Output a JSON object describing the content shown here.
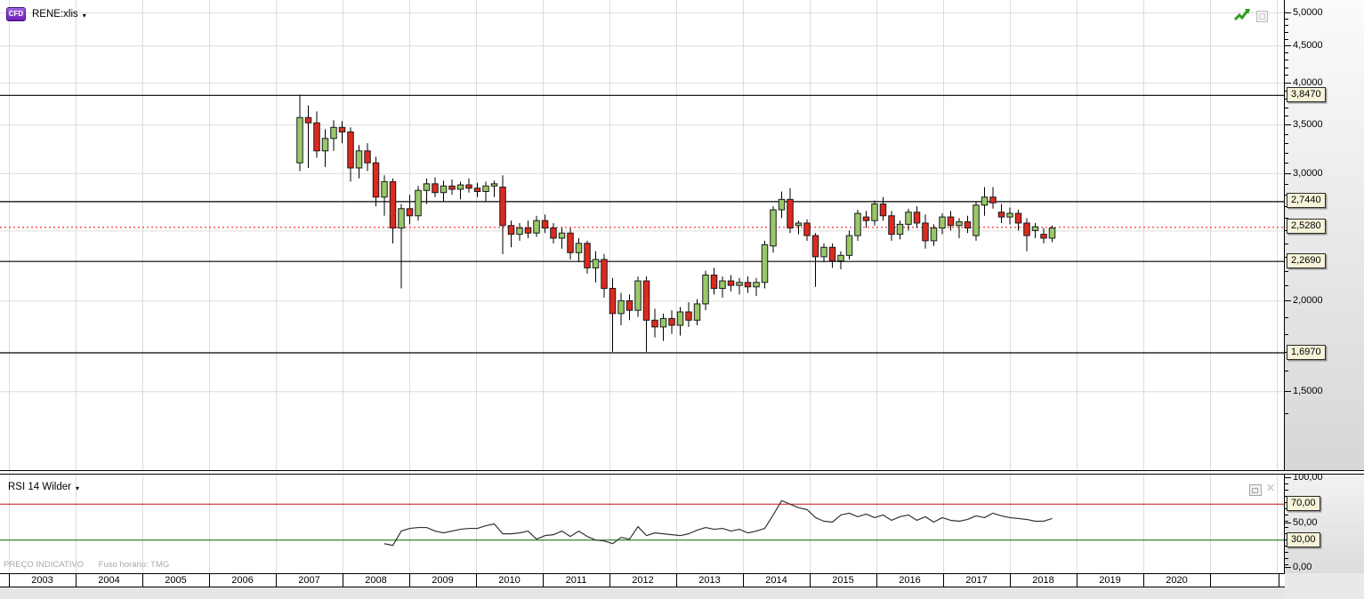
{
  "header": {
    "badge": "CFD",
    "symbol": "RENE:xlis",
    "caret": "▾"
  },
  "rsi_panel": {
    "label": "RSI 14 Wilder",
    "caret": "▾",
    "close_glyph": "✕"
  },
  "footer": {
    "price_note": "PREÇO INDICATIVO",
    "timezone_note": "Fuso horário: TMG"
  },
  "price_axis": {
    "labels": [
      [
        "5,0000",
        5.0
      ],
      [
        "4,5000",
        4.5
      ],
      [
        "4,0000",
        4.0
      ],
      [
        "3,5000",
        3.5
      ],
      [
        "3,0000",
        3.0
      ],
      [
        "2,0000",
        2.0
      ],
      [
        "1,5000",
        1.5
      ]
    ],
    "level_boxes": [
      [
        "3,8470",
        3.847
      ],
      [
        "2,7440",
        2.744
      ],
      [
        "2,5280",
        2.528
      ],
      [
        "2,2690",
        2.269
      ],
      [
        "1,6970",
        1.697
      ]
    ]
  },
  "rsi_axis": {
    "labels": [
      [
        "100,00",
        100
      ],
      [
        "50,00",
        50
      ],
      [
        "0,00",
        0
      ]
    ],
    "level_boxes": [
      [
        "70,00",
        70
      ],
      [
        "30,00",
        30
      ]
    ]
  },
  "time_axis": {
    "years": [
      "2003",
      "2004",
      "2005",
      "2006",
      "2007",
      "2008",
      "2009",
      "2010",
      "2011",
      "2012",
      "2013",
      "2014",
      "2015",
      "2016",
      "2017",
      "2018",
      "2019",
      "2020"
    ]
  },
  "icons": {
    "trend_icon": "green-zigzag-up-arrow",
    "collapse_icon": "square-button",
    "restore_icon": "restore-button",
    "close_icon": "close-button"
  },
  "chart_data": [
    {
      "type": "candlestick",
      "title": "RENE:xlis",
      "y_scale": "log",
      "ylim": [
        1.35,
        5.05
      ],
      "grid_prices": [
        5.0,
        4.5,
        4.0,
        3.5,
        3.0,
        2.5,
        2.0,
        1.5
      ],
      "level_lines": {
        "color": "#000000",
        "prices": [
          3.847,
          2.744,
          2.269,
          1.697
        ]
      },
      "last_price_line": {
        "price": 2.528,
        "color": "#ff0000",
        "style": "dotted"
      },
      "up_color": "#98c868",
      "down_color": "#dd2a1e",
      "wick_color": "#000000",
      "body_border": "#1a1a1a",
      "x_range_years": [
        "mid-2007",
        "late-2018"
      ],
      "ohlc": [
        [
          3.1,
          3.85,
          3.02,
          3.58
        ],
        [
          3.58,
          3.72,
          3.05,
          3.52
        ],
        [
          3.52,
          3.65,
          3.15,
          3.22
        ],
        [
          3.22,
          3.45,
          3.06,
          3.35
        ],
        [
          3.35,
          3.55,
          3.22,
          3.47
        ],
        [
          3.47,
          3.54,
          3.3,
          3.42
        ],
        [
          3.42,
          3.47,
          2.92,
          3.05
        ],
        [
          3.05,
          3.28,
          2.95,
          3.22
        ],
        [
          3.22,
          3.3,
          3.02,
          3.1
        ],
        [
          3.1,
          3.16,
          2.7,
          2.78
        ],
        [
          2.78,
          2.98,
          2.62,
          2.92
        ],
        [
          2.92,
          2.95,
          2.4,
          2.52
        ],
        [
          2.52,
          2.72,
          2.08,
          2.68
        ],
        [
          2.68,
          2.8,
          2.55,
          2.62
        ],
        [
          2.62,
          2.88,
          2.58,
          2.84
        ],
        [
          2.84,
          2.95,
          2.72,
          2.9
        ],
        [
          2.9,
          2.96,
          2.78,
          2.82
        ],
        [
          2.82,
          2.93,
          2.74,
          2.88
        ],
        [
          2.88,
          2.94,
          2.8,
          2.85
        ],
        [
          2.85,
          2.92,
          2.76,
          2.89
        ],
        [
          2.89,
          2.95,
          2.82,
          2.86
        ],
        [
          2.86,
          2.91,
          2.78,
          2.83
        ],
        [
          2.83,
          2.92,
          2.74,
          2.88
        ],
        [
          2.88,
          2.93,
          2.78,
          2.9
        ],
        [
          2.87,
          2.98,
          2.32,
          2.54
        ],
        [
          2.54,
          2.58,
          2.37,
          2.47
        ],
        [
          2.47,
          2.56,
          2.42,
          2.52
        ],
        [
          2.52,
          2.58,
          2.44,
          2.48
        ],
        [
          2.48,
          2.62,
          2.45,
          2.58
        ],
        [
          2.58,
          2.63,
          2.48,
          2.52
        ],
        [
          2.52,
          2.56,
          2.4,
          2.44
        ],
        [
          2.44,
          2.52,
          2.36,
          2.48
        ],
        [
          2.48,
          2.52,
          2.28,
          2.33
        ],
        [
          2.33,
          2.44,
          2.26,
          2.4
        ],
        [
          2.4,
          2.42,
          2.18,
          2.22
        ],
        [
          2.22,
          2.34,
          2.12,
          2.28
        ],
        [
          2.28,
          2.32,
          2.02,
          2.08
        ],
        [
          2.08,
          2.15,
          1.7,
          1.92
        ],
        [
          1.92,
          2.05,
          1.85,
          2.0
        ],
        [
          2.0,
          2.04,
          1.88,
          1.94
        ],
        [
          1.94,
          2.16,
          1.9,
          2.13
        ],
        [
          2.13,
          2.16,
          1.7,
          1.88
        ],
        [
          1.88,
          1.95,
          1.78,
          1.84
        ],
        [
          1.84,
          1.92,
          1.76,
          1.89
        ],
        [
          1.89,
          1.94,
          1.8,
          1.85
        ],
        [
          1.85,
          1.96,
          1.79,
          1.93
        ],
        [
          1.93,
          1.99,
          1.84,
          1.88
        ],
        [
          1.88,
          2.01,
          1.85,
          1.98
        ],
        [
          1.98,
          2.2,
          1.94,
          2.17
        ],
        [
          2.17,
          2.22,
          2.04,
          2.08
        ],
        [
          2.08,
          2.16,
          2.02,
          2.13
        ],
        [
          2.13,
          2.17,
          2.06,
          2.1
        ],
        [
          2.1,
          2.15,
          2.04,
          2.12
        ],
        [
          2.12,
          2.16,
          2.05,
          2.09
        ],
        [
          2.09,
          2.15,
          2.03,
          2.12
        ],
        [
          2.12,
          2.42,
          2.08,
          2.39
        ],
        [
          2.38,
          2.7,
          2.33,
          2.67
        ],
        [
          2.67,
          2.83,
          2.6,
          2.76
        ],
        [
          2.76,
          2.86,
          2.48,
          2.52
        ],
        [
          2.54,
          2.58,
          2.47,
          2.56
        ],
        [
          2.56,
          2.59,
          2.42,
          2.46
        ],
        [
          2.46,
          2.48,
          2.09,
          2.3
        ],
        [
          2.3,
          2.4,
          2.26,
          2.37
        ],
        [
          2.37,
          2.4,
          2.22,
          2.27
        ],
        [
          2.27,
          2.34,
          2.21,
          2.31
        ],
        [
          2.31,
          2.5,
          2.28,
          2.46
        ],
        [
          2.46,
          2.67,
          2.42,
          2.64
        ],
        [
          2.61,
          2.66,
          2.52,
          2.58
        ],
        [
          2.58,
          2.75,
          2.54,
          2.72
        ],
        [
          2.72,
          2.78,
          2.58,
          2.62
        ],
        [
          2.62,
          2.66,
          2.42,
          2.47
        ],
        [
          2.47,
          2.58,
          2.43,
          2.55
        ],
        [
          2.55,
          2.68,
          2.5,
          2.65
        ],
        [
          2.65,
          2.7,
          2.52,
          2.56
        ],
        [
          2.56,
          2.63,
          2.36,
          2.42
        ],
        [
          2.42,
          2.55,
          2.38,
          2.52
        ],
        [
          2.52,
          2.64,
          2.47,
          2.61
        ],
        [
          2.61,
          2.66,
          2.5,
          2.54
        ],
        [
          2.54,
          2.6,
          2.44,
          2.57
        ],
        [
          2.57,
          2.62,
          2.48,
          2.52
        ],
        [
          2.46,
          2.74,
          2.42,
          2.71
        ],
        [
          2.71,
          2.87,
          2.62,
          2.78
        ],
        [
          2.78,
          2.87,
          2.68,
          2.73
        ],
        [
          2.65,
          2.72,
          2.56,
          2.61
        ],
        [
          2.61,
          2.69,
          2.55,
          2.64
        ],
        [
          2.64,
          2.67,
          2.5,
          2.56
        ],
        [
          2.56,
          2.6,
          2.34,
          2.46
        ],
        [
          2.5,
          2.56,
          2.44,
          2.53
        ],
        [
          2.47,
          2.52,
          2.4,
          2.44
        ],
        [
          2.44,
          2.54,
          2.41,
          2.52
        ]
      ]
    },
    {
      "type": "line",
      "name": "RSI 14 Wilder",
      "period": 14,
      "color": "#333333",
      "ylim": [
        0,
        100
      ],
      "ticks": [
        100,
        70,
        50,
        30,
        0
      ],
      "overbought": {
        "value": 70,
        "color": "#cc1111"
      },
      "oversold": {
        "value": 30,
        "color": "#006600"
      },
      "start_index": 10,
      "values": [
        26,
        24,
        40,
        43,
        44,
        44,
        40,
        38,
        40,
        42,
        43,
        43,
        46,
        48,
        37,
        37,
        38,
        40,
        31,
        35,
        36,
        40,
        34,
        40,
        34,
        30,
        29,
        26,
        33,
        31,
        45,
        35,
        38,
        37,
        36,
        35,
        37,
        41,
        44,
        42,
        43,
        40,
        42,
        38,
        40,
        43,
        58,
        74,
        70,
        66,
        64,
        55,
        51,
        50,
        58,
        60,
        56,
        59,
        55,
        58,
        52,
        56,
        58,
        52,
        56,
        50,
        55,
        52,
        51,
        53,
        57,
        55,
        60,
        57,
        55,
        54,
        53,
        51,
        51,
        54
      ]
    }
  ]
}
